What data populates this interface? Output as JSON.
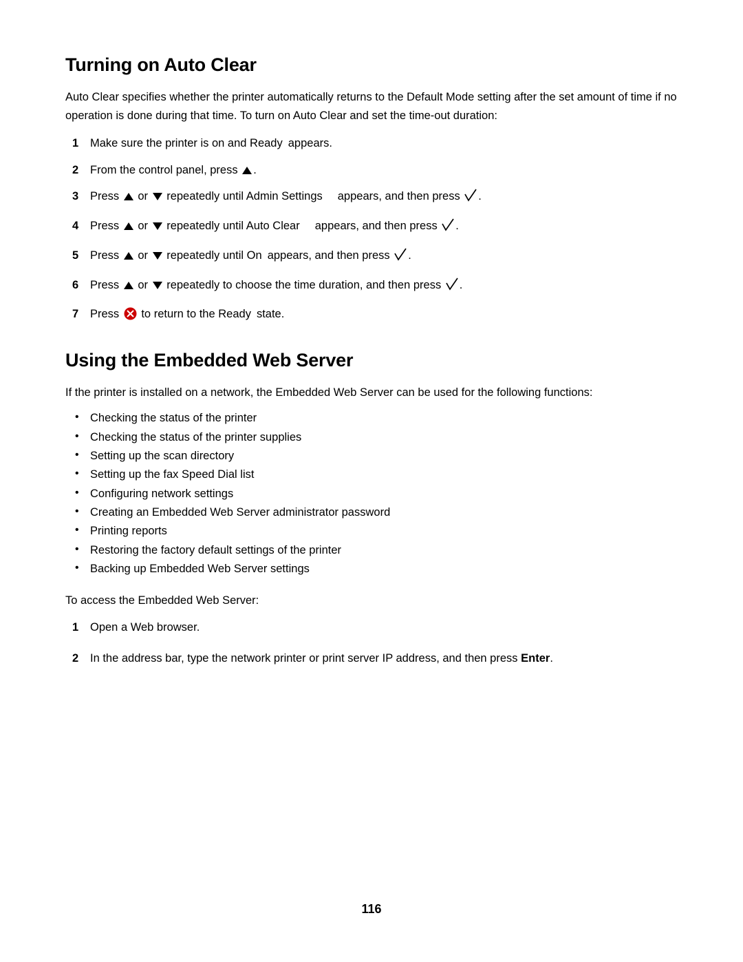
{
  "document": {
    "page_number": "116",
    "sections": [
      {
        "title": "Turning on Auto Clear",
        "intro": "Auto Clear specifies whether the printer automatically returns to the Default Mode setting after the set amount of time if no operation is done during that time. To turn on Auto Clear and set the time-out duration:",
        "steps": [
          {
            "num": "1",
            "parts": [
              {
                "type": "text",
                "text": "Make sure the printer is on and Ready"
              },
              {
                "type": "gap-sm"
              },
              {
                "type": "text",
                "text": "appears."
              }
            ]
          },
          {
            "num": "2",
            "parts": [
              {
                "type": "text",
                "text": "From the control panel, press "
              },
              {
                "type": "arrow-up"
              },
              {
                "type": "text",
                "text": "."
              }
            ]
          },
          {
            "num": "3",
            "parts": [
              {
                "type": "text",
                "text": "Press "
              },
              {
                "type": "arrow-up"
              },
              {
                "type": "text",
                "text": " or "
              },
              {
                "type": "arrow-down"
              },
              {
                "type": "text",
                "text": " repeatedly until Admin Settings"
              },
              {
                "type": "gap"
              },
              {
                "type": "text",
                "text": "appears, and then press "
              },
              {
                "type": "check"
              },
              {
                "type": "text",
                "text": "."
              }
            ]
          },
          {
            "num": "4",
            "parts": [
              {
                "type": "text",
                "text": "Press "
              },
              {
                "type": "arrow-up"
              },
              {
                "type": "text",
                "text": " or "
              },
              {
                "type": "arrow-down"
              },
              {
                "type": "text",
                "text": " repeatedly until Auto Clear"
              },
              {
                "type": "gap"
              },
              {
                "type": "text",
                "text": "appears, and then press "
              },
              {
                "type": "check"
              },
              {
                "type": "text",
                "text": "."
              }
            ]
          },
          {
            "num": "5",
            "parts": [
              {
                "type": "text",
                "text": "Press "
              },
              {
                "type": "arrow-up"
              },
              {
                "type": "text",
                "text": " or "
              },
              {
                "type": "arrow-down"
              },
              {
                "type": "text",
                "text": " repeatedly until On"
              },
              {
                "type": "gap-sm"
              },
              {
                "type": "text",
                "text": "appears, and then press "
              },
              {
                "type": "check"
              },
              {
                "type": "text",
                "text": "."
              }
            ]
          },
          {
            "num": "6",
            "parts": [
              {
                "type": "text",
                "text": "Press "
              },
              {
                "type": "arrow-up"
              },
              {
                "type": "text",
                "text": " or "
              },
              {
                "type": "arrow-down"
              },
              {
                "type": "text",
                "text": " repeatedly to choose the time duration, and then press "
              },
              {
                "type": "check"
              },
              {
                "type": "text",
                "text": "."
              }
            ]
          },
          {
            "num": "7",
            "parts": [
              {
                "type": "text",
                "text": "Press "
              },
              {
                "type": "xbutton"
              },
              {
                "type": "text",
                "text": " to return to the Ready"
              },
              {
                "type": "gap-sm"
              },
              {
                "type": "text",
                "text": "state."
              }
            ]
          }
        ]
      },
      {
        "title": "Using the Embedded Web Server",
        "intro": "If the printer is installed on a network, the Embedded Web Server can be used for the following functions:",
        "bullets": [
          "Checking the status of the printer",
          "Checking the status of the printer supplies",
          "Setting up the scan directory",
          "Setting up the fax Speed Dial list",
          "Configuring network settings",
          "Creating an Embedded Web Server administrator password",
          "Printing reports",
          "Restoring the factory default settings of the printer",
          "Backing up Embedded Web Server settings"
        ],
        "access_line": "To access the Embedded Web Server:",
        "steps": [
          {
            "num": "1",
            "parts": [
              {
                "type": "text",
                "text": "Open a Web browser."
              }
            ]
          },
          {
            "num": "2",
            "parts": [
              {
                "type": "text",
                "text": "In the address bar, type the network printer or print server IP address, and then press "
              },
              {
                "type": "bold",
                "text": "Enter"
              },
              {
                "type": "text",
                "text": "."
              }
            ]
          }
        ]
      }
    ],
    "bullet_glyph": "•",
    "colors": {
      "stop_button": "#cc0000",
      "text": "#000000"
    }
  }
}
